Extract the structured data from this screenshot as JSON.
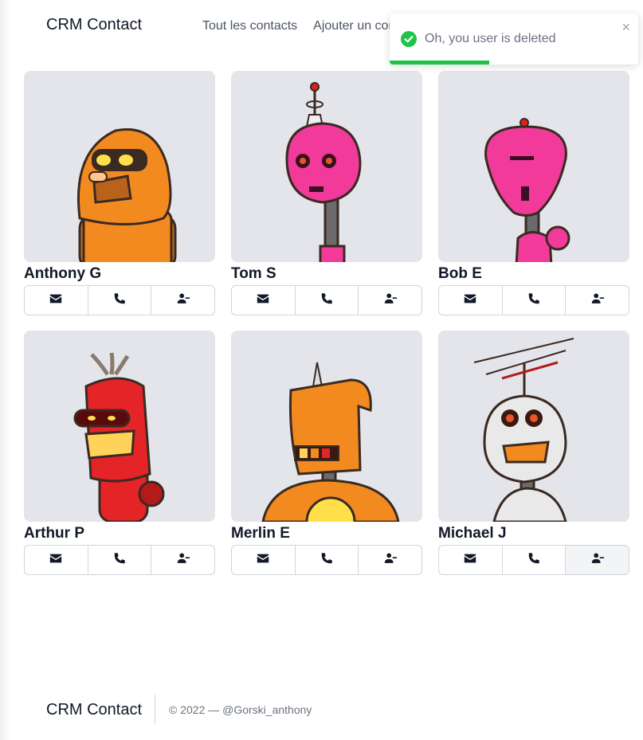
{
  "header": {
    "brand": "CRM Contact",
    "nav": [
      "Tout les contacts",
      "Ajouter un contact"
    ]
  },
  "contacts": [
    {
      "name": "Anthony G",
      "robot_color": "#f28a20",
      "avatar": "orange-robot-avatar"
    },
    {
      "name": "Tom S",
      "robot_color": "#f23a9a",
      "avatar": "pink-robot-avatar"
    },
    {
      "name": "Bob E",
      "robot_color": "#f23a9a",
      "avatar": "pink-robot-avatar"
    },
    {
      "name": "Arthur P",
      "robot_color": "#e42426",
      "avatar": "red-robot-avatar"
    },
    {
      "name": "Merlin E",
      "robot_color": "#f28a20",
      "avatar": "orange-robot-avatar"
    },
    {
      "name": "Michael J",
      "robot_color": "#e9e9e9",
      "avatar": "white-robot-avatar"
    }
  ],
  "actions": [
    "mail-icon",
    "phone-icon",
    "remove-user-icon"
  ],
  "toast": {
    "message": "Oh, you user is deleted",
    "close": "×",
    "progress": 0.4,
    "accent": "#1fc34a"
  },
  "footer": {
    "brand": "CRM Contact",
    "copyright": "© 2022 — @Gorski_anthony"
  },
  "colors": {
    "avatar_bg": "#e4e5ea",
    "border": "#d1d5db"
  }
}
